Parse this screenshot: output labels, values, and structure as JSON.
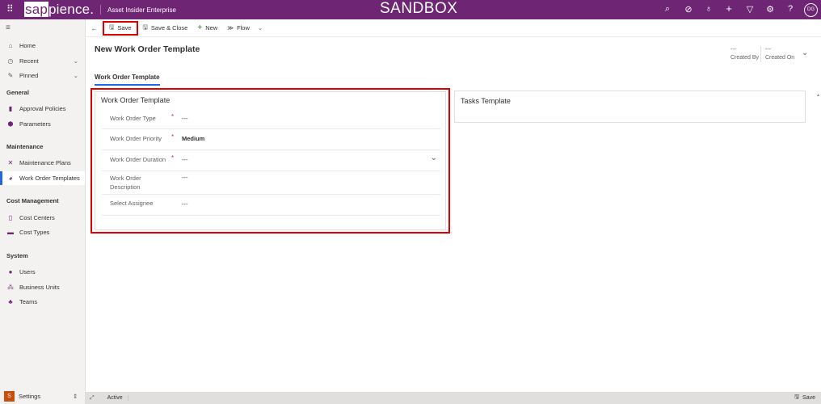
{
  "topbar": {
    "brand": "sappience.",
    "brand_box": "sap",
    "brand_rest": "pience.",
    "app_name": "Asset Insider Enterprise",
    "environment": "SANDBOX",
    "avatar_initials": "DG"
  },
  "sidebar": {
    "home": "Home",
    "recent": "Recent",
    "pinned": "Pinned",
    "sections": [
      {
        "title": "General",
        "items": [
          "Approval Policies",
          "Parameters"
        ]
      },
      {
        "title": "Maintenance",
        "items": [
          "Maintenance Plans",
          "Work Order Templates"
        ]
      },
      {
        "title": "Cost Management",
        "items": [
          "Cost Centers",
          "Cost Types"
        ]
      },
      {
        "title": "System",
        "items": [
          "Users",
          "Business Units",
          "Teams"
        ]
      }
    ],
    "area": "Settings",
    "area_badge": "S"
  },
  "commandbar": {
    "save": "Save",
    "save_close": "Save & Close",
    "new": "New",
    "flow": "Flow"
  },
  "header": {
    "title": "New Work Order Template",
    "created_by_value": "---",
    "created_by_label": "Created By",
    "created_on_value": "---",
    "created_on_label": "Created On"
  },
  "tabs": [
    "Work Order Template"
  ],
  "form": {
    "section_title": "Work Order Template",
    "fields": [
      {
        "label": "Work Order Type",
        "required": "*",
        "value": "---"
      },
      {
        "label": "Work Order Priority",
        "required": "*",
        "value": "Medium"
      },
      {
        "label": "Work Order Duration",
        "required": "*",
        "value": "---"
      },
      {
        "label": "Work Order Description",
        "required": "",
        "value": "---"
      },
      {
        "label": "Select Assignee",
        "required": "",
        "value": "---"
      }
    ]
  },
  "tasks": {
    "section_title": "Tasks Template"
  },
  "statusbar": {
    "status": "Active",
    "save": "Save"
  }
}
